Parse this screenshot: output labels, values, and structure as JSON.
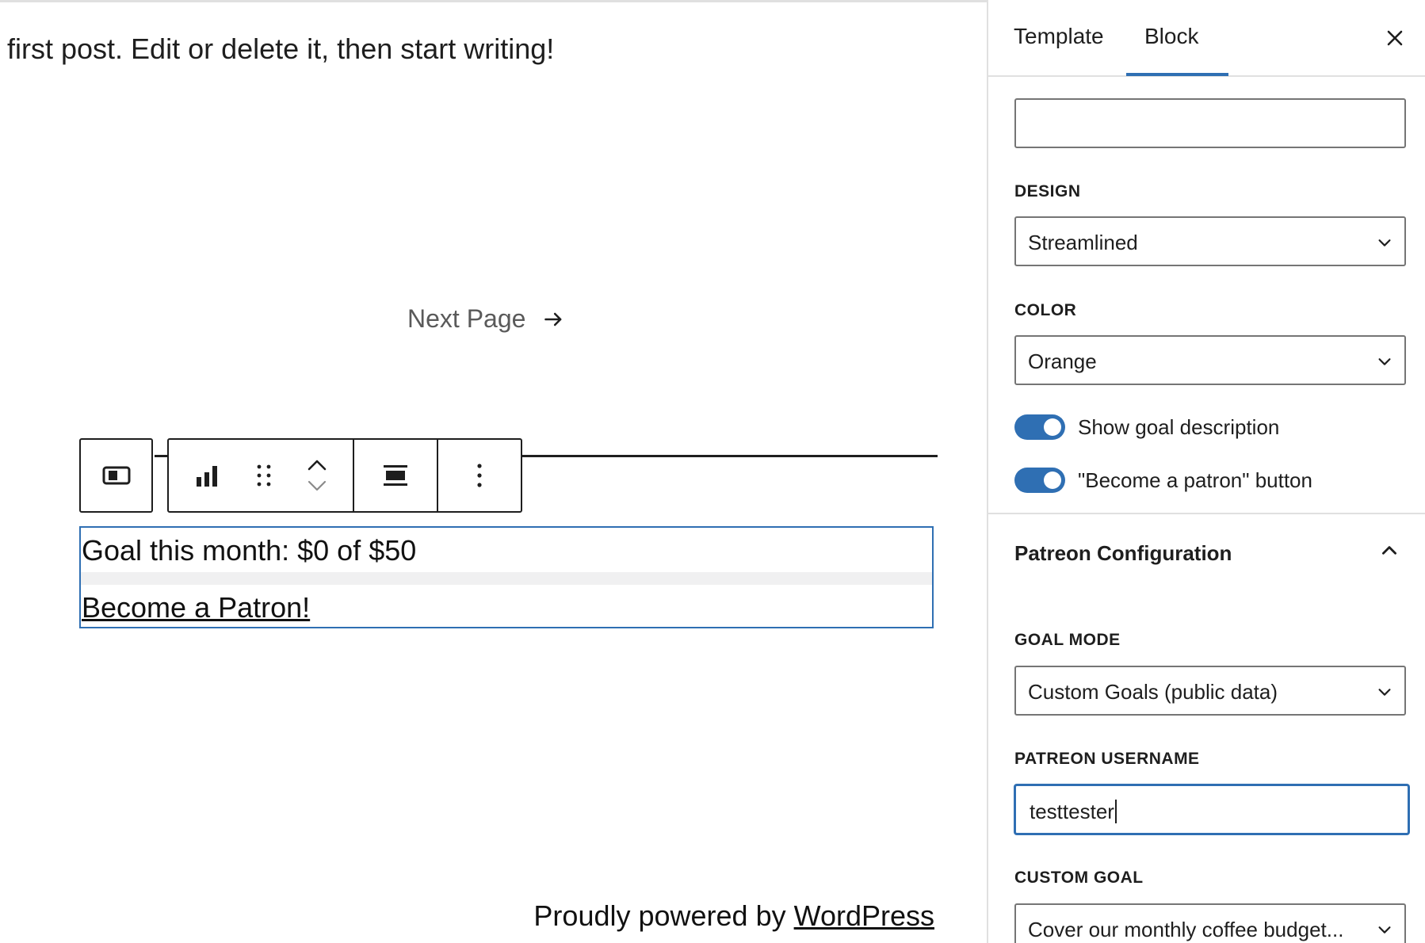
{
  "canvas": {
    "post_text": "first post. Edit or delete it, then start writing!",
    "next_page_label": "Next Page",
    "block": {
      "goal_text": "Goal this month: $0 of $50",
      "goal_progress_fraction": 0,
      "link_text": "Become a Patron!"
    },
    "footer": {
      "prefix": "Proudly powered by ",
      "link": "WordPress"
    }
  },
  "toolbar": {
    "icons": [
      "block-parent-icon",
      "chart-icon",
      "drag-handle-icon",
      "move-up-icon",
      "move-down-icon",
      "align-icon",
      "more-options-icon"
    ]
  },
  "sidebar": {
    "tabs": [
      {
        "label": "Template",
        "active": false
      },
      {
        "label": "Block",
        "active": true
      }
    ],
    "top_input_value": "",
    "design": {
      "label": "DESIGN",
      "value": "Streamlined"
    },
    "color": {
      "label": "COLOR",
      "value": "Orange"
    },
    "toggles": [
      {
        "label": "Show goal description",
        "on": true
      },
      {
        "label": "\"Become a patron\" button",
        "on": true
      }
    ],
    "panel": {
      "title": "Patreon Configuration",
      "expanded": true,
      "goal_mode": {
        "label": "GOAL MODE",
        "value": "Custom Goals (public data)"
      },
      "username": {
        "label": "PATREON USERNAME",
        "value": "testtester"
      },
      "custom_goal": {
        "label": "CUSTOM GOAL",
        "value": "Cover our monthly coffee budget..."
      }
    }
  },
  "colors": {
    "accent": "#2f6fb3",
    "text": "#1e1e1e",
    "muted_text": "#5a5a5a",
    "border": "#757575",
    "divider": "#e0e0e0"
  }
}
